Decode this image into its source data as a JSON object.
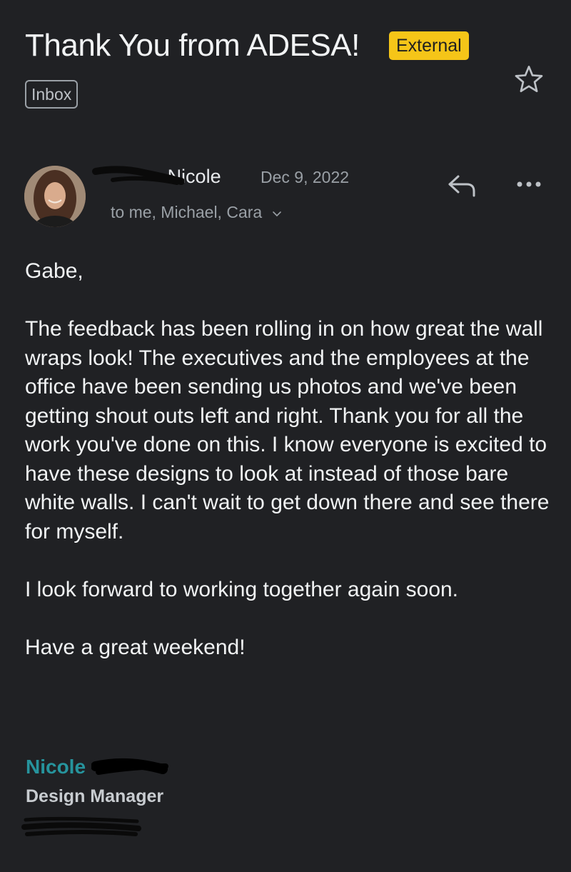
{
  "email": {
    "subject": "Thank You from ADESA!",
    "external_badge": "External",
    "label": "Inbox",
    "icons": {
      "star": "star-icon",
      "reply": "reply-icon",
      "more": "more-horizontal-icon",
      "expand": "chevron-down-icon"
    }
  },
  "sender": {
    "name_visible": "Nicole",
    "date": "Dec 9, 2022",
    "recipients": "to me, Michael, Cara"
  },
  "message": {
    "greeting": "Gabe,",
    "paragraph_1": "The feedback has been rolling in on how great the wall wraps look! The executives and the employees at the office have been sending us photos and we've been getting shout outs left and right. Thank you for all the work you've done on this. I know everyone is excited to have these designs to look at instead of those bare white walls. I can't wait to get down there and see there for myself.",
    "paragraph_2": "I look forward to working together again soon.",
    "closing": "Have a great weekend!"
  },
  "signature": {
    "name": "Nicole",
    "title": "Design Manager"
  },
  "colors": {
    "background": "#202124",
    "badge_bg": "#f5c518",
    "signature_name": "#26949d",
    "secondary_text": "#9aa0a6"
  }
}
